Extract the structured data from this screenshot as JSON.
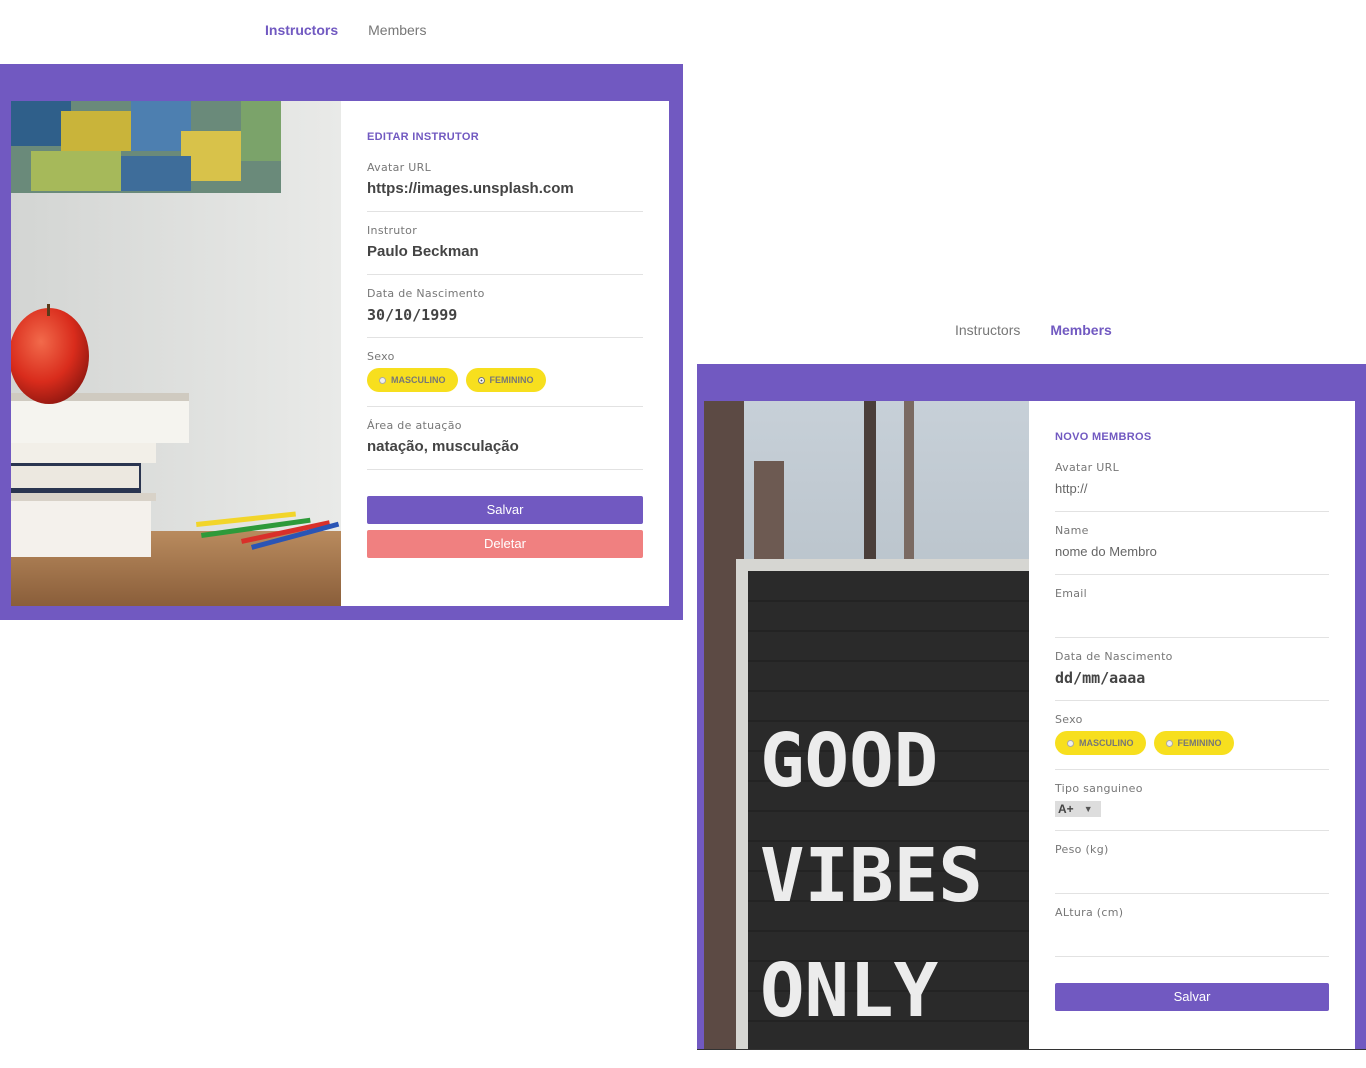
{
  "instructor_page": {
    "nav": {
      "instructors": "Instructors",
      "members": "Members"
    },
    "form_title": "EDITAR INSTRUTOR",
    "fields": {
      "avatar_label": "Avatar URL",
      "avatar_value": "https://images.unsplash.com",
      "name_label": "Instrutor",
      "name_value": "Paulo Beckman",
      "birth_label": "Data de Nascimento",
      "birth_value": "30/10/1999",
      "gender_label": "Sexo",
      "gender_male": "MASCULINO",
      "gender_female": "FEMININO",
      "gender_selected": "FEMININO",
      "area_label": "Área de atuação",
      "area_value": "natação, musculação"
    },
    "save_label": "Salvar",
    "delete_label": "Deletar"
  },
  "member_page": {
    "nav": {
      "instructors": "Instructors",
      "members": "Members"
    },
    "form_title": "NOVO MEMBROS",
    "fields": {
      "avatar_label": "Avatar URL",
      "avatar_placeholder": "http://",
      "name_label": "Name",
      "name_placeholder": "nome do Membro",
      "email_label": "Email",
      "birth_label": "Data de Nascimento",
      "birth_value": "dd/mm/aaaa",
      "gender_label": "Sexo",
      "gender_male": "MASCULINO",
      "gender_female": "FEMININO",
      "blood_label": "Tipo sanguineo",
      "blood_value": "A+",
      "weight_label": "Peso (kg)",
      "height_label": "ALtura (cm)"
    },
    "sign_text": [
      "GOOD",
      "VIBES",
      "ONLY"
    ],
    "save_label": "Salvar"
  },
  "colors": {
    "accent": "#7159c1",
    "radio": "#f7df1e",
    "delete": "#f08080"
  }
}
